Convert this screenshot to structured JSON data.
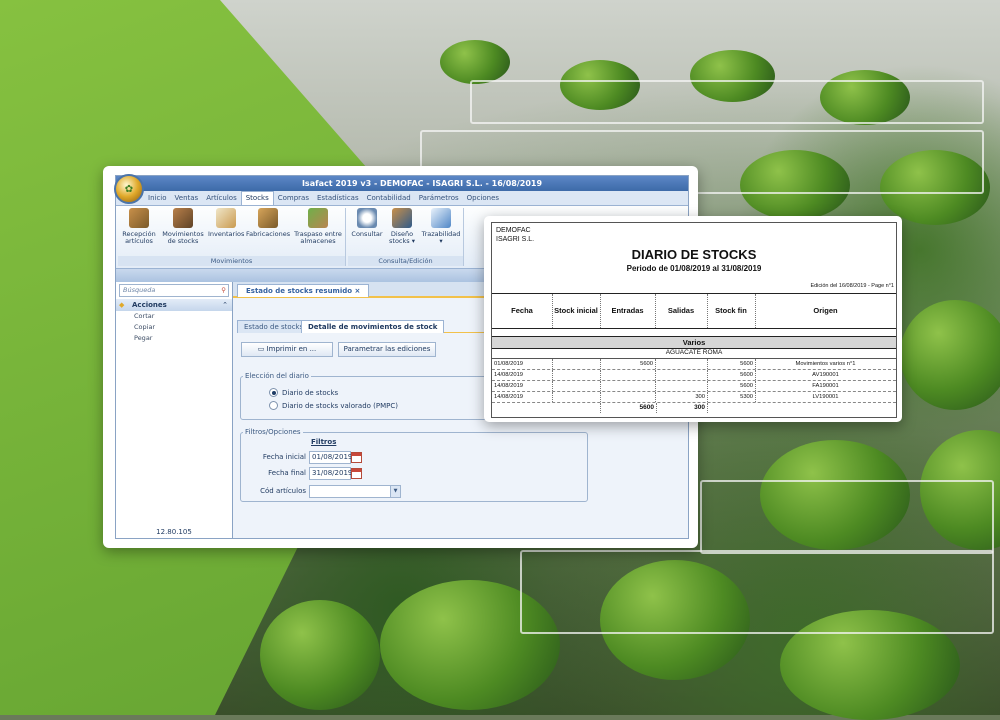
{
  "app": {
    "title": "Isafact 2019 v3 - DEMOFAC - ISAGRI S.L. - 16/08/2019",
    "menu": [
      "Inicio",
      "Ventas",
      "Artículos",
      "Stocks",
      "Compras",
      "Estadísticas",
      "Contabilidad",
      "Parámetros",
      "Opciones"
    ],
    "active_menu": "Stocks",
    "ribbon": {
      "movimientos": {
        "label": "Movimientos",
        "buttons": [
          "Recepción artículos",
          "Movimientos de stocks",
          "Inventarios",
          "Fabricaciones",
          "Traspaso entre almacenes"
        ]
      },
      "consulta": {
        "label": "Consulta/Edición",
        "buttons": [
          "Consultar",
          "Diseño stocks ▾",
          "Trazabilidad ▾"
        ]
      }
    },
    "sidebar": {
      "search_placeholder": "Búsqueda",
      "section": "Acciones",
      "items": [
        "Cortar",
        "Copiar",
        "Pegar"
      ],
      "version": "12.80.105"
    },
    "doc_tab": "Estado de stocks resumido  ×",
    "sub_tabs": [
      "Estado de stocks",
      "Detalle de movimientos de stock"
    ],
    "buttons": {
      "print": "Imprimir en ...",
      "params": "Parametrar las ediciones"
    },
    "diario": {
      "legend": "Elección del diario",
      "options": [
        "Diario de stocks",
        "Diario de stocks valorado (PMPC)"
      ],
      "selected": "Diario de stocks"
    },
    "filtros": {
      "legend": "Filtros/Opciones",
      "heading": "Filtros",
      "fecha_inicial_label": "Fecha inicial",
      "fecha_inicial": "01/08/2019",
      "fecha_final_label": "Fecha final",
      "fecha_final": "31/08/2019",
      "cod_label": "Cód artículos",
      "cod_value": ""
    }
  },
  "report": {
    "company": "DEMOFAC",
    "company2": "ISAGRI S.L.",
    "title": "DIARIO DE STOCKS",
    "period": "Periodo de 01/08/2019  al  31/08/2019",
    "edition": "Edición del 16/08/2019 - Page n°1",
    "columns": [
      "Fecha",
      "Stock inicial",
      "Entradas",
      "Salidas",
      "Stock fin",
      "Origen"
    ],
    "group": "Varios",
    "article": "AGUACATE ROMA",
    "rows": [
      {
        "fecha": "01/08/2019",
        "inicial": "",
        "entradas": "5600",
        "salidas": "",
        "fin": "5600",
        "origen": "Movimientos varios n°1"
      },
      {
        "fecha": "14/08/2019",
        "inicial": "",
        "entradas": "",
        "salidas": "",
        "fin": "5600",
        "origen": "AV190001"
      },
      {
        "fecha": "14/08/2019",
        "inicial": "",
        "entradas": "",
        "salidas": "",
        "fin": "5600",
        "origen": "FA190001"
      },
      {
        "fecha": "14/08/2019",
        "inicial": "",
        "entradas": "",
        "salidas": "300",
        "fin": "5300",
        "origen": "LV190001"
      }
    ],
    "totals": {
      "entradas": "5600",
      "salidas": "300"
    }
  }
}
